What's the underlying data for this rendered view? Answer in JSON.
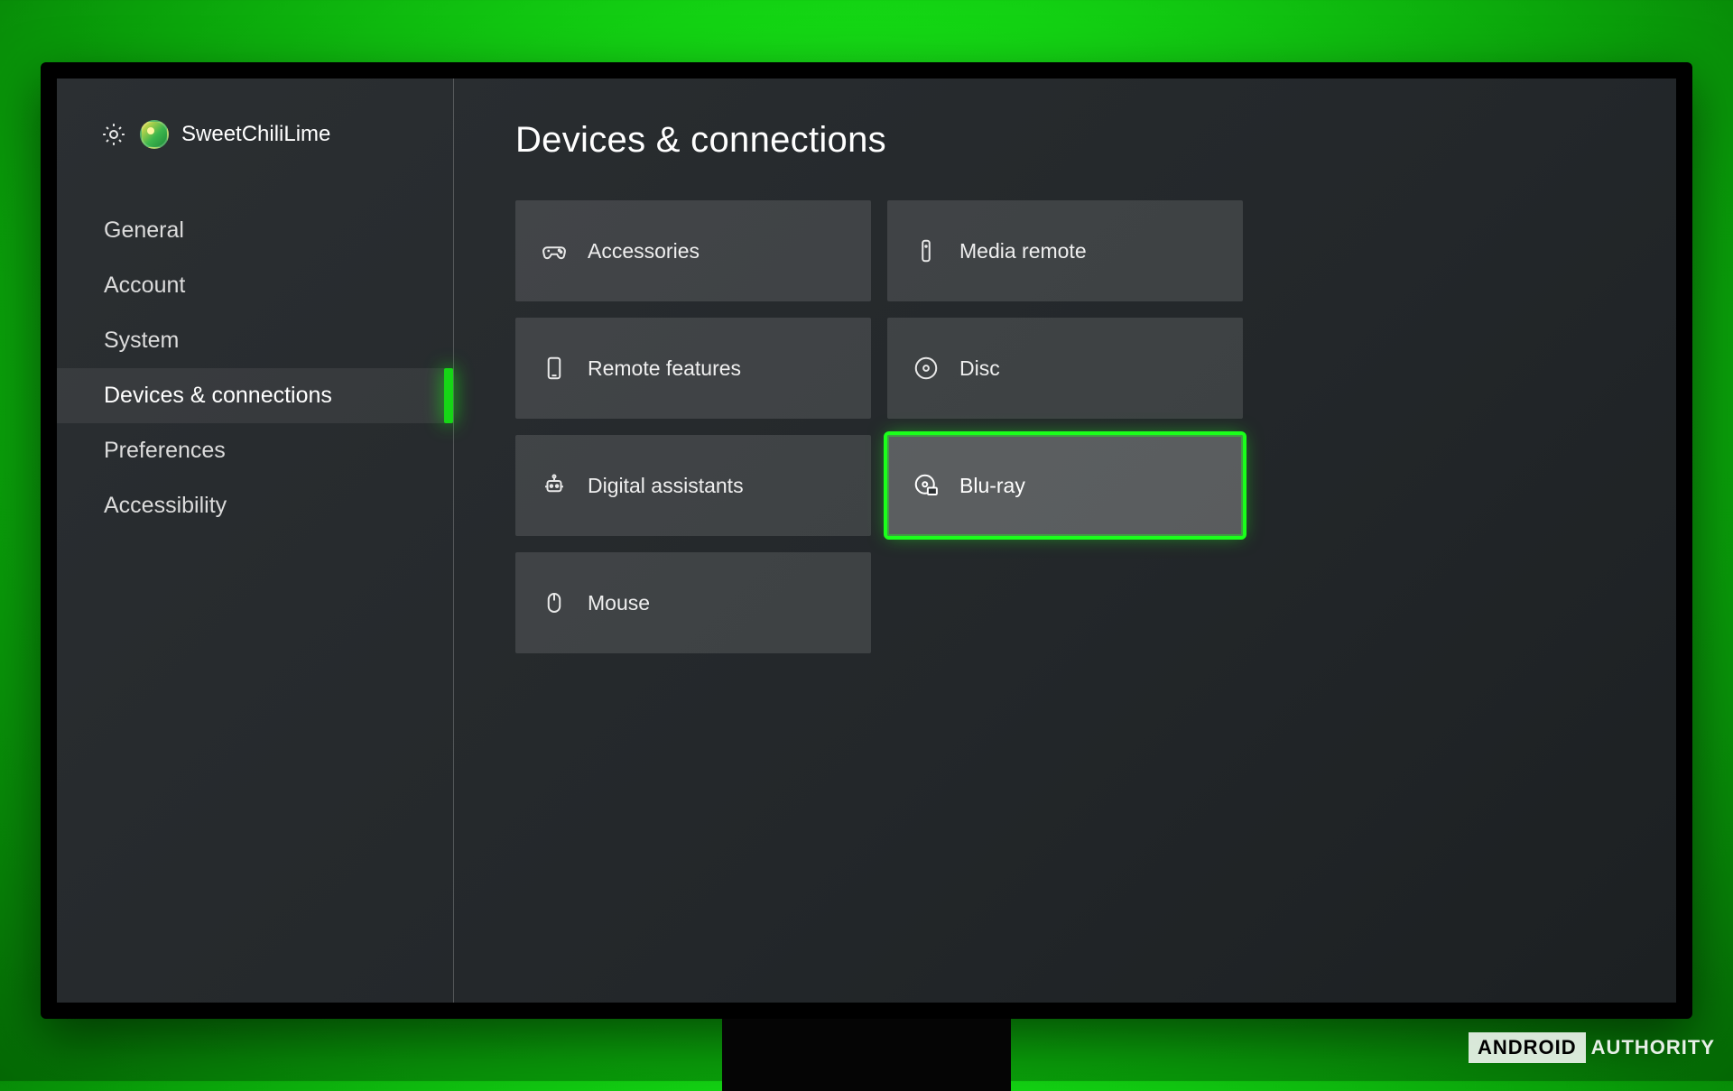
{
  "header": {
    "username": "SweetChiliLime"
  },
  "sidebar": {
    "items": [
      {
        "label": "General",
        "active": false
      },
      {
        "label": "Account",
        "active": false
      },
      {
        "label": "System",
        "active": false
      },
      {
        "label": "Devices & connections",
        "active": true
      },
      {
        "label": "Preferences",
        "active": false
      },
      {
        "label": "Accessibility",
        "active": false
      }
    ]
  },
  "main": {
    "title": "Devices & connections",
    "tiles": [
      {
        "id": "accessories",
        "label": "Accessories",
        "icon": "controller-icon",
        "selected": false
      },
      {
        "id": "media-remote",
        "label": "Media remote",
        "icon": "remote-icon",
        "selected": false
      },
      {
        "id": "remote-features",
        "label": "Remote features",
        "icon": "phone-icon",
        "selected": false
      },
      {
        "id": "disc",
        "label": "Disc",
        "icon": "disc-icon",
        "selected": false
      },
      {
        "id": "digital-assistants",
        "label": "Digital assistants",
        "icon": "assistant-icon",
        "selected": false
      },
      {
        "id": "blu-ray",
        "label": "Blu-ray",
        "icon": "bluray-icon",
        "selected": true
      },
      {
        "id": "mouse",
        "label": "Mouse",
        "icon": "mouse-icon",
        "selected": false
      }
    ]
  },
  "watermark": {
    "part1": "ANDROID",
    "part2": "AUTHORITY"
  },
  "colors": {
    "accent": "#1bff1b",
    "tile_bg": "rgba(255,255,255,0.12)",
    "tile_bg_selected": "rgba(255,255,255,0.25)"
  }
}
